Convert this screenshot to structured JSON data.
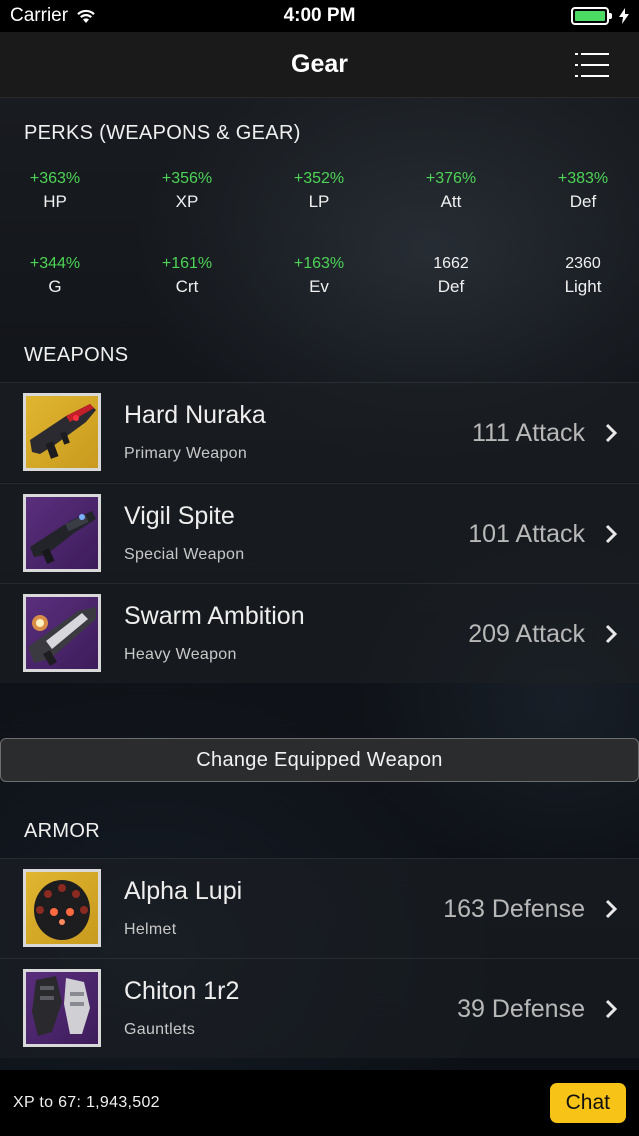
{
  "status_bar": {
    "carrier": "Carrier",
    "time": "4:00 PM"
  },
  "nav": {
    "title": "Gear"
  },
  "perks": {
    "header": "PERKS (WEAPONS & GEAR)",
    "items": [
      {
        "value": "+363%",
        "label": "HP",
        "color": "green"
      },
      {
        "value": "+356%",
        "label": "XP",
        "color": "green"
      },
      {
        "value": "+352%",
        "label": "LP",
        "color": "green"
      },
      {
        "value": "+376%",
        "label": "Att",
        "color": "green"
      },
      {
        "value": "+383%",
        "label": "Def",
        "color": "green"
      },
      {
        "value": "+344%",
        "label": "G",
        "color": "green"
      },
      {
        "value": "+161%",
        "label": "Crt",
        "color": "green"
      },
      {
        "value": "+163%",
        "label": "Ev",
        "color": "green"
      },
      {
        "value": "1662",
        "label": "Def",
        "color": "white"
      },
      {
        "value": "2360",
        "label": "Light",
        "color": "white"
      }
    ]
  },
  "weapons": {
    "header": "WEAPONS",
    "items": [
      {
        "name": "Hard Nuraka",
        "type": "Primary Weapon",
        "stat": "111 Attack",
        "icon": "auto-rifle-icon"
      },
      {
        "name": "Vigil Spite",
        "type": "Special Weapon",
        "stat": "101 Attack",
        "icon": "fusion-rifle-icon"
      },
      {
        "name": "Swarm Ambition",
        "type": "Heavy Weapon",
        "stat": "209 Attack",
        "icon": "rocket-launcher-icon"
      }
    ],
    "change_button": "Change Equipped Weapon"
  },
  "armor": {
    "header": "ARMOR",
    "items": [
      {
        "name": "Alpha Lupi",
        "type": "Helmet",
        "stat": "163 Defense",
        "icon": "helmet-icon"
      },
      {
        "name": "Chiton 1r2",
        "type": "Gauntlets",
        "stat": "39 Defense",
        "icon": "gauntlets-icon"
      }
    ]
  },
  "footer": {
    "xp_text": "XP to 67: 1,943,502",
    "chat_label": "Chat"
  },
  "colors": {
    "accent_green": "#4cd455",
    "chat_yellow": "#f7c316",
    "battery_green": "#4cd964"
  }
}
